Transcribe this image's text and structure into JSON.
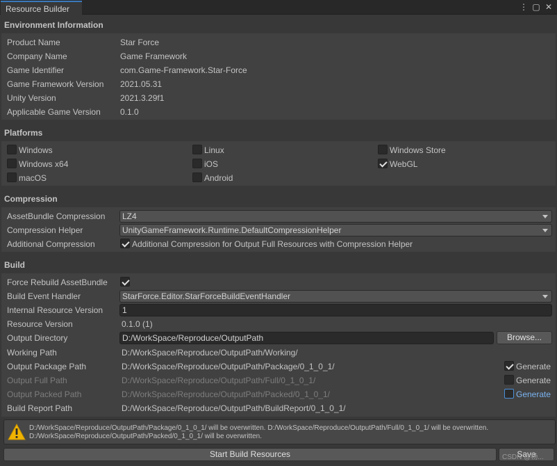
{
  "window": {
    "tab_title": "Resource Builder",
    "menu_icon": "kebab-menu-icon",
    "maximize_icon": "maximize-icon",
    "close_icon": "close-icon"
  },
  "environment": {
    "header": "Environment Information",
    "rows": [
      {
        "label": "Product Name",
        "value": "Star Force"
      },
      {
        "label": "Company Name",
        "value": "Game Framework"
      },
      {
        "label": "Game Identifier",
        "value": "com.Game-Framework.Star-Force"
      },
      {
        "label": "Game Framework Version",
        "value": "2021.05.31"
      },
      {
        "label": "Unity Version",
        "value": "2021.3.29f1"
      },
      {
        "label": "Applicable Game Version",
        "value": "0.1.0"
      }
    ]
  },
  "platforms": {
    "header": "Platforms",
    "items": [
      {
        "label": "Windows",
        "checked": false
      },
      {
        "label": "Linux",
        "checked": false
      },
      {
        "label": "Windows Store",
        "checked": false
      },
      {
        "label": "Windows x64",
        "checked": false
      },
      {
        "label": "iOS",
        "checked": false
      },
      {
        "label": "WebGL",
        "checked": true
      },
      {
        "label": "macOS",
        "checked": false
      },
      {
        "label": "Android",
        "checked": false
      }
    ]
  },
  "compression": {
    "header": "Compression",
    "assetbundle_label": "AssetBundle Compression",
    "assetbundle_value": "LZ4",
    "helper_label": "Compression Helper",
    "helper_value": "UnityGameFramework.Runtime.DefaultCompressionHelper",
    "additional_label": "Additional Compression",
    "additional_checked": true,
    "additional_text": "Additional Compression for Output Full Resources with Compression Helper"
  },
  "build": {
    "header": "Build",
    "force_rebuild_label": "Force Rebuild AssetBundle",
    "force_rebuild_checked": true,
    "event_handler_label": "Build Event Handler",
    "event_handler_value": "StarForce.Editor.StarForceBuildEventHandler",
    "internal_version_label": "Internal Resource Version",
    "internal_version_value": "1",
    "resource_version_label": "Resource Version",
    "resource_version_value": "0.1.0 (1)",
    "output_dir_label": "Output Directory",
    "output_dir_value": "D:/WorkSpace/Reproduce/OutputPath",
    "browse_label": "Browse...",
    "working_path_label": "Working Path",
    "working_path_value": "D:/WorkSpace/Reproduce/OutputPath/Working/",
    "package_path_label": "Output Package Path",
    "package_path_value": "D:/WorkSpace/Reproduce/OutputPath/Package/0_1_0_1/",
    "package_generate": "Generate",
    "package_generate_checked": true,
    "full_path_label": "Output Full Path",
    "full_path_value": "D:/WorkSpace/Reproduce/OutputPath/Full/0_1_0_1/",
    "full_generate": "Generate",
    "full_generate_checked": false,
    "packed_path_label": "Output Packed Path",
    "packed_path_value": "D:/WorkSpace/Reproduce/OutputPath/Packed/0_1_0_1/",
    "packed_generate": "Generate",
    "packed_generate_checked": false,
    "report_path_label": "Build Report Path",
    "report_path_value": "D:/WorkSpace/Reproduce/OutputPath/BuildReport/0_1_0_1/"
  },
  "warning": {
    "line1": "D:/WorkSpace/Reproduce/OutputPath/Package/0_1_0_1/ will be overwritten. D:/WorkSpace/Reproduce/OutputPath/Full/0_1_0_1/ will be overwritten.",
    "line2": "D:/WorkSpace/Reproduce/OutputPath/Packed/0_1_0_1/ will be overwritten."
  },
  "footer": {
    "start_build_label": "Start Build Resources",
    "save_label": "Save",
    "watermark": "CSDN @杨..."
  }
}
